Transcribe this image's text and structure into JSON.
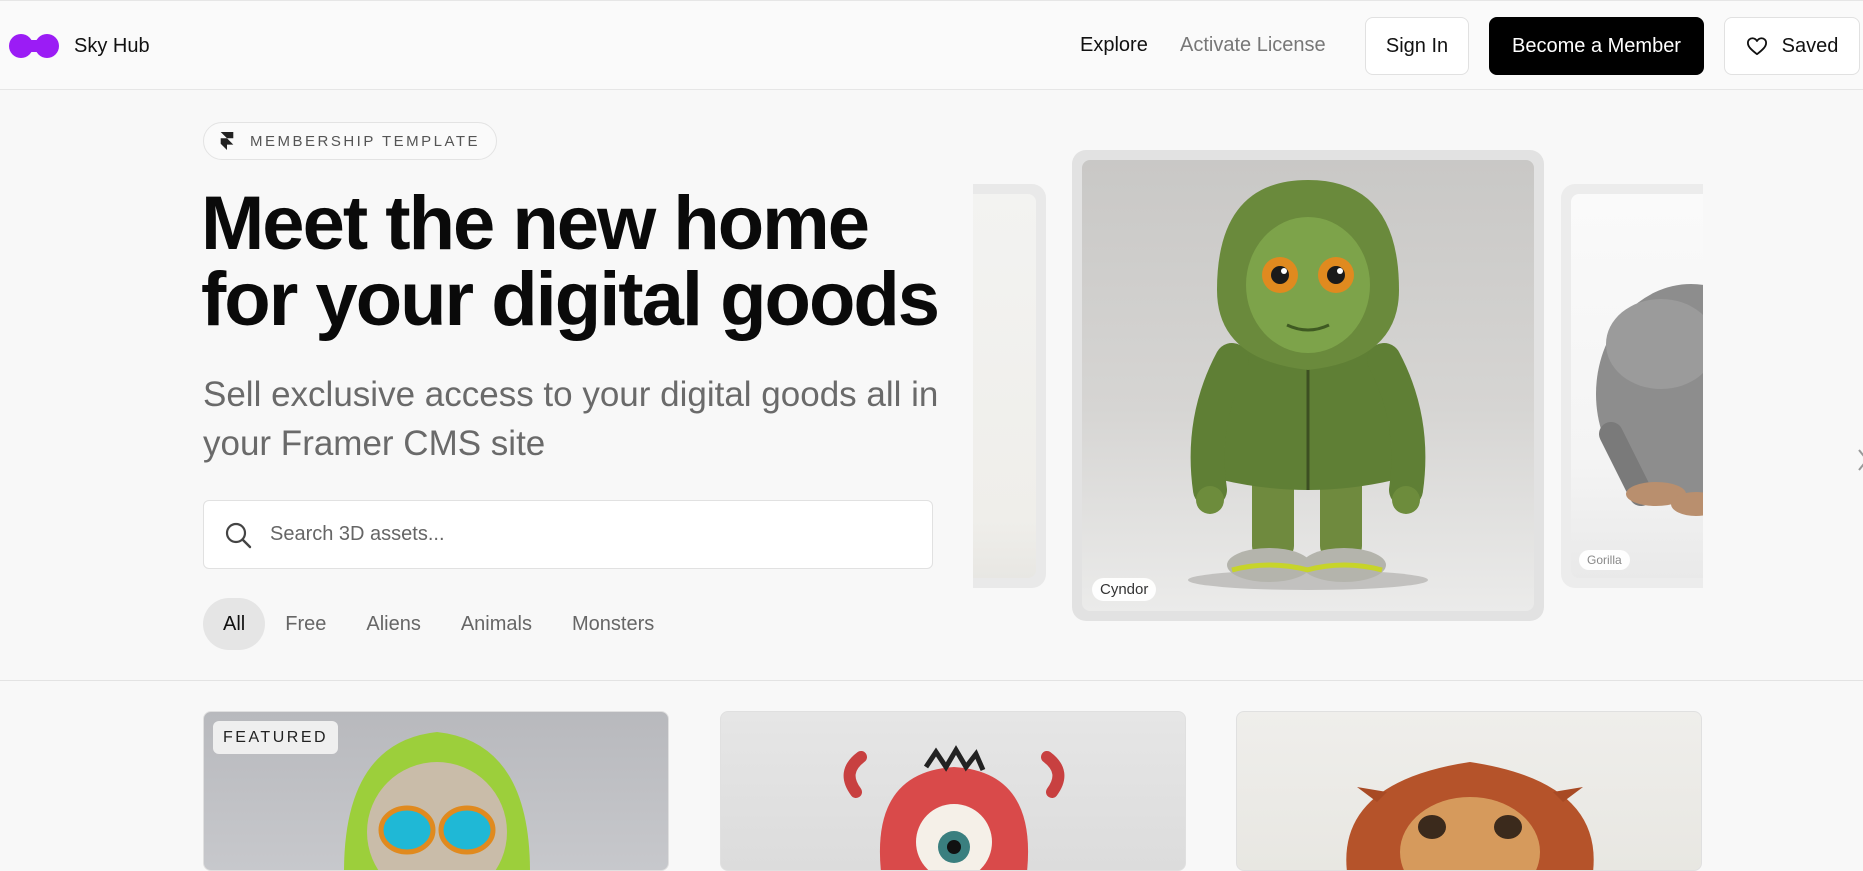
{
  "header": {
    "brand_name": "Sky Hub",
    "nav": {
      "explore": "Explore",
      "activate_license": "Activate License"
    },
    "buttons": {
      "sign_in": "Sign In",
      "become_member": "Become a Member",
      "saved": "Saved"
    },
    "logo_color": "#9b1cf5"
  },
  "hero": {
    "badge": "MEMBERSHIP TEMPLATE",
    "headline": "Meet the new home for your digital goods",
    "subhead": "Sell exclusive access to your digital goods all in your Framer CMS site",
    "search": {
      "placeholder": "Search 3D assets..."
    },
    "filters": [
      {
        "label": "All",
        "active": true
      },
      {
        "label": "Free",
        "active": false
      },
      {
        "label": "Aliens",
        "active": false
      },
      {
        "label": "Animals",
        "active": false
      },
      {
        "label": "Monsters",
        "active": false
      }
    ],
    "carousel": {
      "main_label": "Cyndor",
      "right_label": "Gorilla"
    }
  },
  "grid": {
    "featured_tag": "FEATURED",
    "items": [
      {
        "icon": "alien-hoodie-image"
      },
      {
        "icon": "red-cyclops-monster-image"
      },
      {
        "icon": "lion-image"
      }
    ]
  }
}
